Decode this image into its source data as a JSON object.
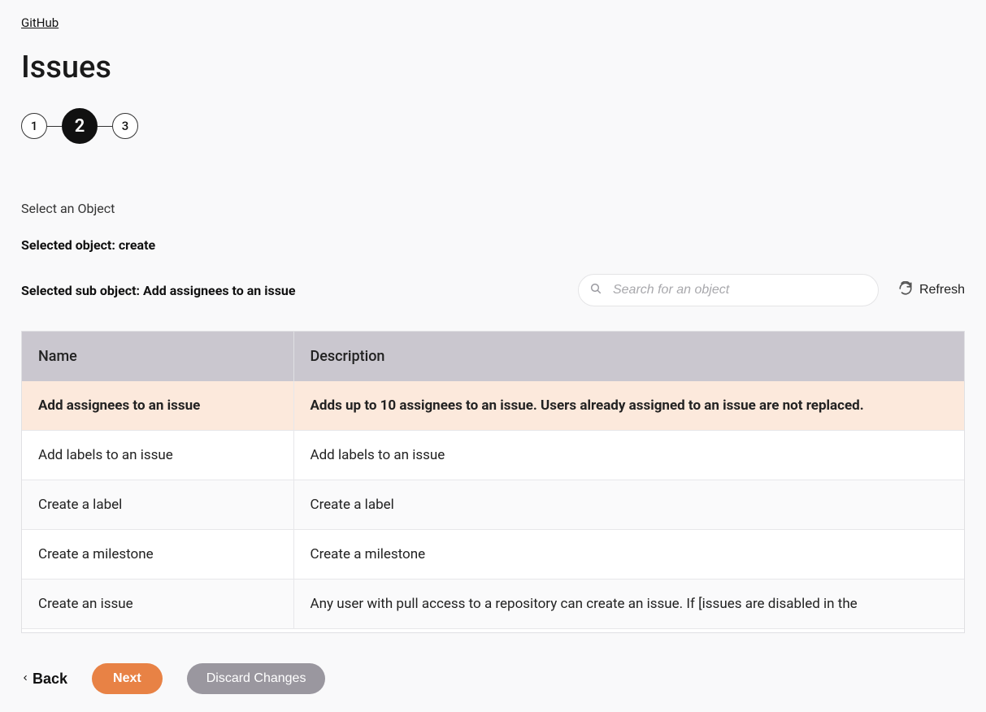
{
  "breadcrumb": {
    "label": "GitHub"
  },
  "page": {
    "title": "Issues"
  },
  "stepper": {
    "steps": [
      {
        "num": "1",
        "active": false
      },
      {
        "num": "2",
        "active": true
      },
      {
        "num": "3",
        "active": false
      }
    ]
  },
  "section": {
    "label": "Select an Object",
    "selected_object_line": "Selected object: create",
    "selected_sub_object_line": "Selected sub object: Add assignees to an issue"
  },
  "search": {
    "placeholder": "Search for an object"
  },
  "refresh": {
    "label": "Refresh"
  },
  "table": {
    "headers": {
      "name": "Name",
      "description": "Description"
    },
    "rows": [
      {
        "name": "Add assignees to an issue",
        "description": "Adds up to 10 assignees to an issue. Users already assigned to an issue are not replaced.",
        "selected": true
      },
      {
        "name": "Add labels to an issue",
        "description": "Add labels to an issue",
        "selected": false
      },
      {
        "name": "Create a label",
        "description": "Create a label",
        "selected": false
      },
      {
        "name": "Create a milestone",
        "description": "Create a milestone",
        "selected": false
      },
      {
        "name": "Create an issue",
        "description": "Any user with pull access to a repository can create an issue. If [issues are disabled in the",
        "selected": false
      }
    ]
  },
  "footer": {
    "back": "Back",
    "next": "Next",
    "discard": "Discard Changes"
  }
}
